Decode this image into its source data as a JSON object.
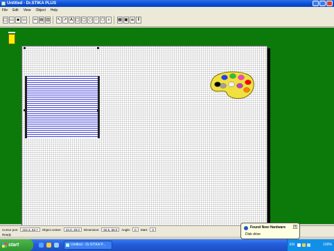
{
  "window": {
    "title": "Untitled - Dr.STIKA PLUS"
  },
  "menu": [
    "File",
    "Edit",
    "View",
    "Object",
    "Help"
  ],
  "toolbar": {
    "buttons": [
      {
        "name": "new-button",
        "glyph": "□"
      },
      {
        "name": "open-button",
        "glyph": "▭"
      },
      {
        "name": "save-button",
        "glyph": "▪"
      },
      {
        "name": "print-button",
        "glyph": "▫"
      },
      {
        "name": "cut-button",
        "glyph": "✂"
      },
      {
        "name": "copy-button",
        "glyph": "▤"
      },
      {
        "name": "paste-button",
        "glyph": "▥"
      },
      {
        "name": "pointer-tool",
        "glyph": "↖"
      },
      {
        "name": "select-tool",
        "glyph": "↗"
      },
      {
        "name": "text-tool",
        "glyph": "A"
      },
      {
        "name": "rectangle-tool",
        "glyph": "□"
      },
      {
        "name": "rounded-rect-tool",
        "glyph": "▢"
      },
      {
        "name": "ellipse-tool",
        "glyph": "○"
      },
      {
        "name": "star-tool",
        "glyph": "☆"
      },
      {
        "name": "polygon-tool",
        "glyph": "⬡"
      },
      {
        "name": "zoom-tool",
        "glyph": "⌕"
      },
      {
        "name": "image-tool",
        "glyph": "▦"
      },
      {
        "name": "frame-tool",
        "glyph": "▣"
      },
      {
        "name": "align-tool",
        "glyph": "≡"
      },
      {
        "name": "distribute-tool",
        "glyph": "⫴"
      }
    ]
  },
  "status": {
    "cursor_label": "Cursor pos:",
    "cursor_value": "224.3, 83.7",
    "center_label": "Object center:",
    "center_value": "34.0, 29.0",
    "dimension_label": "Dimension:",
    "dimension_value": "60.5, 58.0",
    "angle_label": "Angle:",
    "angle_value": "0",
    "start_label": "Start:",
    "start_value": "0",
    "ready": "Ready"
  },
  "balloon": {
    "title": "Found New Hardware",
    "text": "Disk drive",
    "close": "x"
  },
  "taskbar": {
    "start_label": "start",
    "task_label": "Untitled - Dr.STIKA P...",
    "lang": "EN",
    "clock": "100%"
  },
  "colors": {
    "workspace": "#0b7a0b",
    "palette_body": "#f0e040",
    "palette_swatches": [
      "#000000",
      "#2040ff",
      "#30c030",
      "#ff40c0",
      "#ff0000",
      "#a0a0a0",
      "#f0f0f0",
      "#c040c0",
      "#ff8000"
    ]
  },
  "icons": [
    "app-icon",
    "palette-icon",
    "windows-flag-icon",
    "info-icon"
  ]
}
